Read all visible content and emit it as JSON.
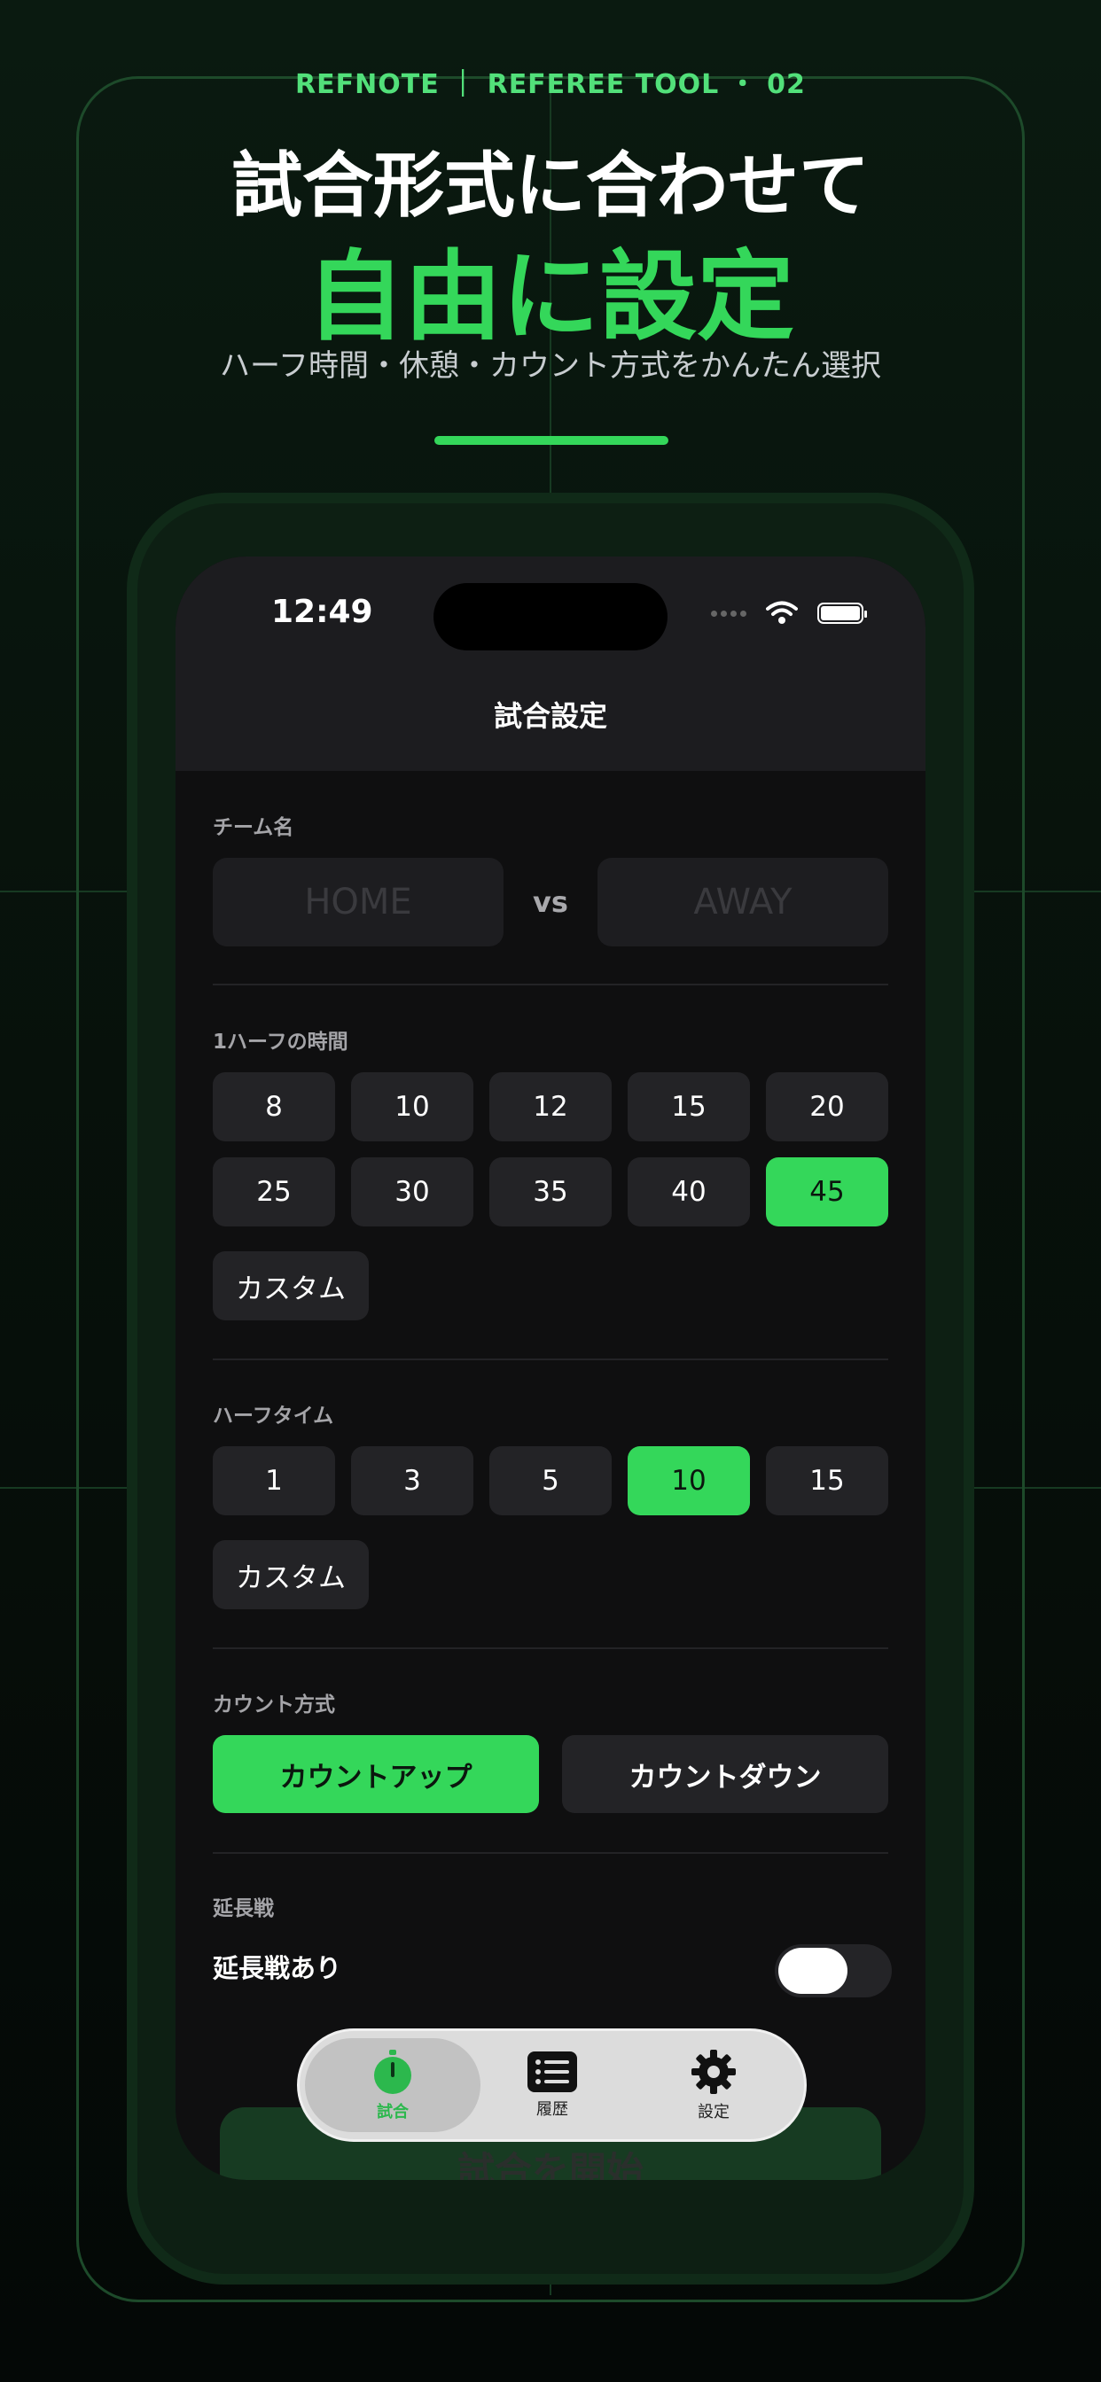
{
  "marketing": {
    "kicker": "REFNOTE ｜ REFEREE TOOL ・ 02",
    "headline": "試合形式に合わせて",
    "headline_accent": "自由に設定",
    "subtitle": "ハーフ時間・休憩・カウント方式をかんたん選択",
    "accent_color": "#34d75a"
  },
  "status_bar": {
    "time": "12:49"
  },
  "nav": {
    "title": "試合設定"
  },
  "team_names": {
    "label": "チーム名",
    "home_placeholder": "HOME",
    "away_placeholder": "AWAY",
    "vs": "vs"
  },
  "half_duration": {
    "label": "1ハーフの時間",
    "options": [
      "8",
      "10",
      "12",
      "15",
      "20",
      "25",
      "30",
      "35",
      "40",
      "45"
    ],
    "selected": "45",
    "custom_label": "カスタム"
  },
  "half_time": {
    "label": "ハーフタイム",
    "options": [
      "1",
      "3",
      "5",
      "10",
      "15"
    ],
    "selected": "10",
    "custom_label": "カスタム"
  },
  "count_mode": {
    "label": "カウント方式",
    "options": [
      "カウントアップ",
      "カウントダウン"
    ],
    "selected": "カウントアップ"
  },
  "extra_time": {
    "label": "延長戦",
    "toggle_label": "延長戦あり",
    "enabled": false
  },
  "start_button": {
    "label": "試合を開始"
  },
  "tab_bar": {
    "items": [
      {
        "label": "試合",
        "icon": "stopwatch-icon",
        "active": true
      },
      {
        "label": "履歴",
        "icon": "list-icon",
        "active": false
      },
      {
        "label": "設定",
        "icon": "gear-icon",
        "active": false
      }
    ]
  }
}
